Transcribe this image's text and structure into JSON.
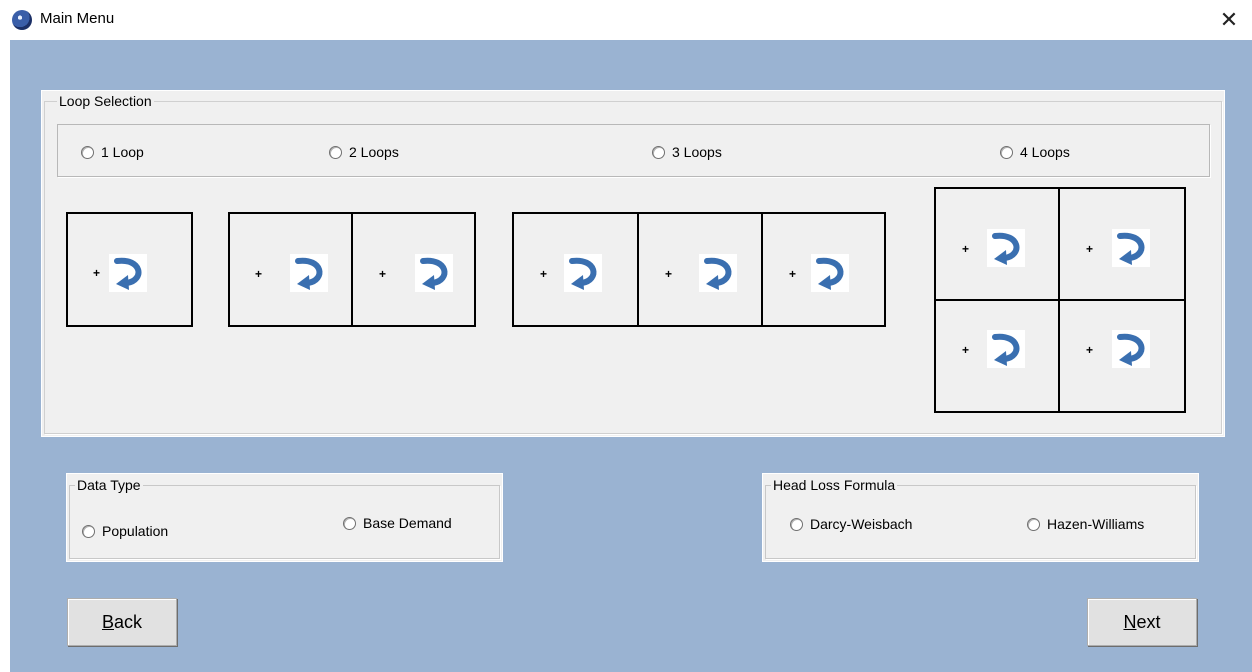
{
  "window": {
    "title": "Main Menu",
    "close_glyph": "✕"
  },
  "loop_selection": {
    "legend": "Loop Selection",
    "options": [
      {
        "label": "1 Loop",
        "selected": false
      },
      {
        "label": "2 Loops",
        "selected": false
      },
      {
        "label": "3 Loops",
        "selected": false
      },
      {
        "label": "4 Loops",
        "selected": false
      }
    ],
    "plus_glyph": "+"
  },
  "data_type": {
    "legend": "Data Type",
    "options": [
      {
        "label": "Population",
        "selected": false
      },
      {
        "label": "Base Demand",
        "selected": false
      }
    ]
  },
  "head_loss": {
    "legend": "Head Loss Formula",
    "options": [
      {
        "label": "Darcy-Weisbach",
        "selected": false
      },
      {
        "label": "Hazen-Williams",
        "selected": false
      }
    ]
  },
  "buttons": {
    "back": {
      "mnemonic": "B",
      "rest": "ack"
    },
    "next": {
      "mnemonic": "N",
      "rest": "ext"
    }
  },
  "colors": {
    "client_background": "#9ab3d2",
    "panel_background": "#f0f0f0",
    "loop_arrow": "#3a6fb0"
  },
  "icons": {
    "app": "globe-icon",
    "close": "close-icon",
    "loop": "curved-arrow-icon",
    "radio": "radio-button-icon"
  }
}
